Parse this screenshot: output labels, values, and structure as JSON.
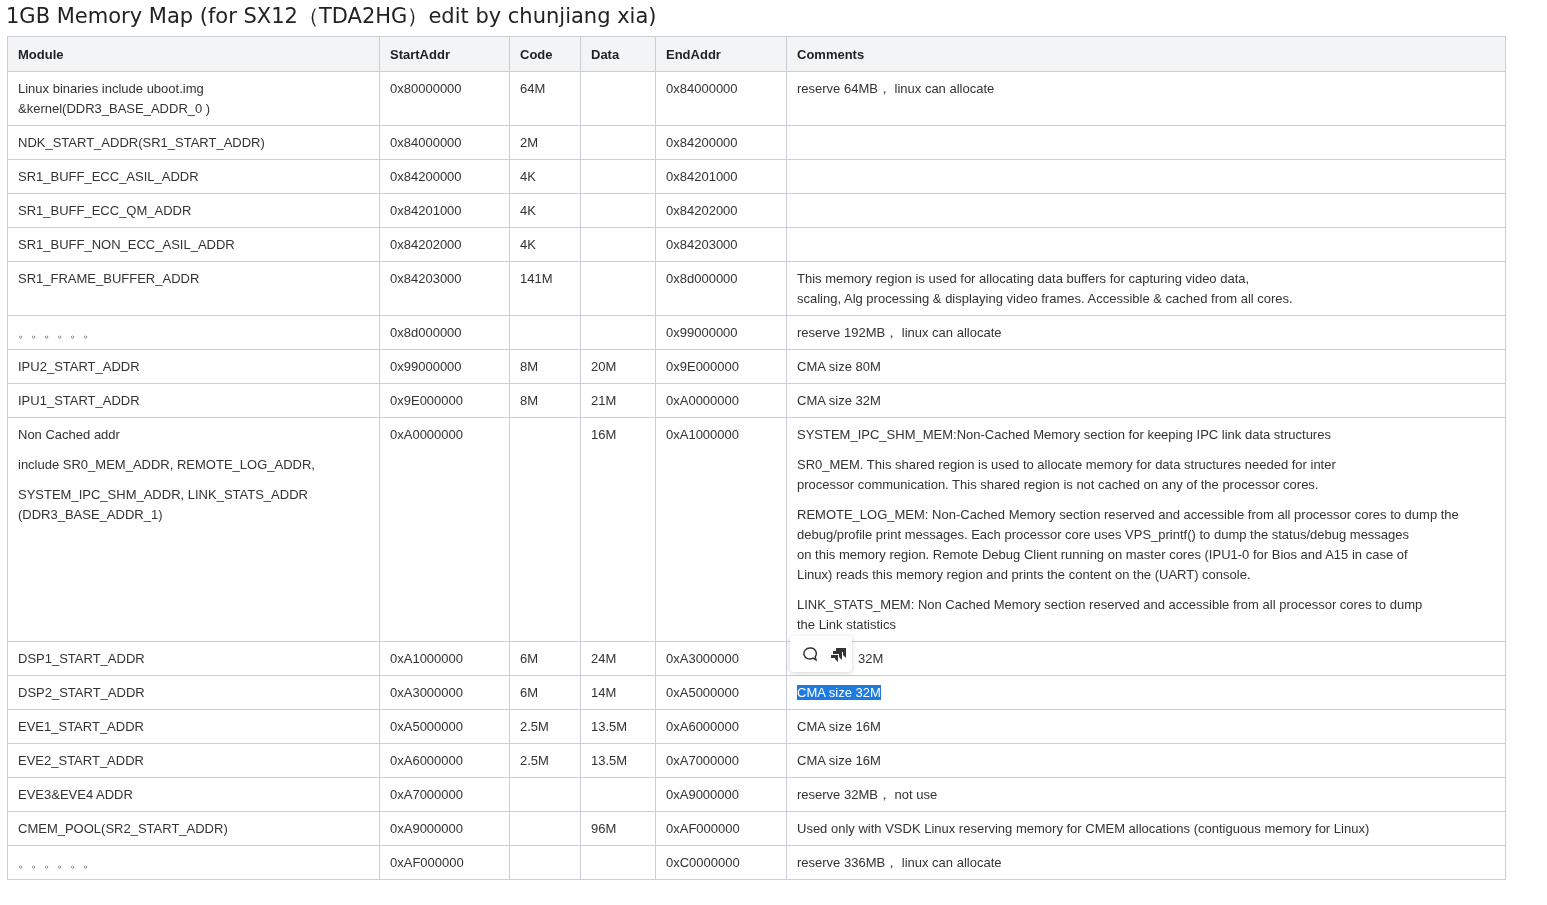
{
  "title": "1GB Memory Map (for SX12（TDA2HG）edit by chunjiang xia)",
  "table": {
    "columns": [
      "Module",
      "StartAddr",
      "Code",
      "Data",
      "EndAddr",
      "Comments"
    ],
    "rows": [
      {
        "module": [
          "Linux binaries include uboot.img\n&kernel(DDR3_BASE_ADDR_0 )"
        ],
        "start": "0x80000000",
        "code": "64M",
        "data": "",
        "end": "0x84000000",
        "comments": [
          "reserve 64MB， linux can allocate"
        ]
      },
      {
        "module": [
          "NDK_START_ADDR(SR1_START_ADDR)"
        ],
        "start": "0x84000000",
        "code": "2M",
        "data": "",
        "end": "0x84200000",
        "comments": []
      },
      {
        "module": [
          "SR1_BUFF_ECC_ASIL_ADDR"
        ],
        "start": "0x84200000",
        "code": "4K",
        "data": "",
        "end": "0x84201000",
        "comments": []
      },
      {
        "module": [
          "SR1_BUFF_ECC_QM_ADDR"
        ],
        "start": "0x84201000",
        "code": "4K",
        "data": "",
        "end": "0x84202000",
        "comments": []
      },
      {
        "module": [
          "SR1_BUFF_NON_ECC_ASIL_ADDR"
        ],
        "start": "0x84202000",
        "code": "4K",
        "data": "",
        "end": "0x84203000",
        "comments": []
      },
      {
        "module": [
          "SR1_FRAME_BUFFER_ADDR"
        ],
        "start": "0x84203000",
        "code": "141M",
        "data": "",
        "end": "0x8d000000",
        "comments": [
          "This memory region is used for allocating data buffers for capturing video data,\nscaling, Alg processing & displaying video frames. Accessible & cached from all cores."
        ]
      },
      {
        "module": [
          "。。。。。。"
        ],
        "start": "0x8d000000",
        "code": "",
        "data": "",
        "end": "0x99000000",
        "comments": [
          "reserve 192MB， linux can allocate"
        ]
      },
      {
        "module": [
          "IPU2_START_ADDR"
        ],
        "start": "0x99000000",
        "code": "8M",
        "data": "20M",
        "end": "0x9E000000",
        "comments": [
          "CMA size 80M"
        ]
      },
      {
        "module": [
          "IPU1_START_ADDR"
        ],
        "start": "0x9E000000",
        "code": "8M",
        "data": "21M",
        "end": "0xA0000000",
        "comments": [
          "CMA size 32M"
        ]
      },
      {
        "module": [
          "Non Cached addr",
          "include SR0_MEM_ADDR, REMOTE_LOG_ADDR,",
          "SYSTEM_IPC_SHM_ADDR, LINK_STATS_ADDR\n(DDR3_BASE_ADDR_1)"
        ],
        "start": "0xA0000000",
        "code": "",
        "data": "16M",
        "end": "0xA1000000",
        "comments": [
          "SYSTEM_IPC_SHM_MEM:Non-Cached Memory section for keeping IPC link data structures",
          "SR0_MEM. This shared region is used to allocate memory for data structures needed for inter\nprocessor communication. This shared region is not cached on any of the processor cores.",
          "REMOTE_LOG_MEM: Non-Cached Memory section reserved and accessible from all processor cores to dump the\ndebug/profile print messages. Each processor core uses VPS_printf() to dump the status/debug messages\non this memory region. Remote Debug Client running on master cores (IPU1-0 for Bios and A15 in case of\nLinux) reads this memory region and prints the content on the (UART) console.",
          "LINK_STATS_MEM: Non Cached Memory section reserved and accessible from all processor cores to dump\nthe Link statistics"
        ]
      },
      {
        "module": [
          "DSP1_START_ADDR"
        ],
        "start": "0xA1000000",
        "code": "6M",
        "data": "24M",
        "end": "0xA3000000",
        "comments": [
          "32M"
        ],
        "toolbar": true
      },
      {
        "module": [
          "DSP2_START_ADDR"
        ],
        "start": "0xA3000000",
        "code": "6M",
        "data": "14M",
        "end": "0xA5000000",
        "comments": [
          "CMA size 32M"
        ],
        "selected": true
      },
      {
        "module": [
          "EVE1_START_ADDR"
        ],
        "start": "0xA5000000",
        "code": "2.5M",
        "data": "13.5M",
        "end": "0xA6000000",
        "comments": [
          "CMA size 16M"
        ]
      },
      {
        "module": [
          "EVE2_START_ADDR"
        ],
        "start": "0xA6000000",
        "code": "2.5M",
        "data": "13.5M",
        "end": "0xA7000000",
        "comments": [
          "CMA size 16M"
        ]
      },
      {
        "module": [
          "EVE3&EVE4 ADDR"
        ],
        "start": "0xA7000000",
        "code": "",
        "data": "",
        "end": "0xA9000000",
        "comments": [
          "reserve 32MB， not use"
        ]
      },
      {
        "module": [
          "CMEM_POOL(SR2_START_ADDR)"
        ],
        "start": "0xA9000000",
        "code": "",
        "data": "96M",
        "end": "0xAF000000",
        "comments": [
          "Used only with VSDK Linux reserving memory for CMEM allocations (contiguous memory for Linux)"
        ]
      },
      {
        "module": [
          "。。。。。。"
        ],
        "start": "0xAF000000",
        "code": "",
        "data": "",
        "end": "0xC0000000",
        "comments": [
          "reserve 336MB， linux can allocate"
        ]
      }
    ]
  }
}
